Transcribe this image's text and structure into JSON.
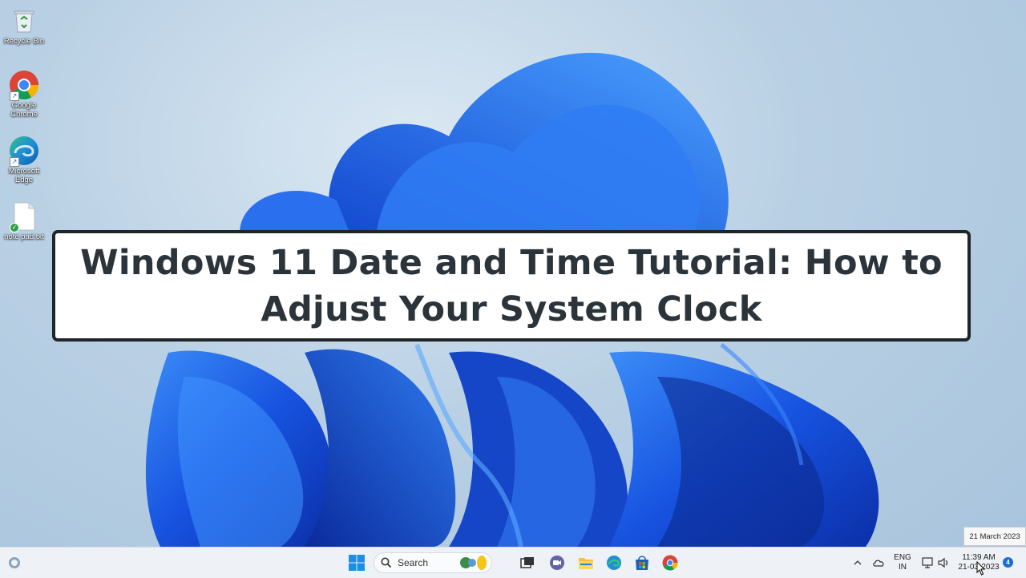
{
  "desktop_icons": [
    {
      "label": "Recycle Bin",
      "icon": "recycle-bin-icon"
    },
    {
      "label": "Google Chrome",
      "icon": "chrome-icon"
    },
    {
      "label": "Microsoft Edge",
      "icon": "edge-icon"
    },
    {
      "label": "note pad.txt",
      "icon": "text-file-icon"
    }
  ],
  "overlay": {
    "title_line1": "Windows 11 Date and Time Tutorial: How to",
    "title_line2": "Adjust Your System Clock"
  },
  "tooltip": {
    "date": "21 March 2023"
  },
  "taskbar": {
    "search_placeholder": "Search",
    "pinned": [
      "start-icon",
      "search-icon",
      "widgets-icon",
      "task-view-icon",
      "teams-chat-icon",
      "file-explorer-icon",
      "edge-icon",
      "store-icon",
      "chrome-icon"
    ],
    "tray": {
      "lang_line1": "ENG",
      "lang_line2": "IN",
      "time": "11:39 AM",
      "date": "21-03-2023",
      "notification_count": "4"
    }
  },
  "colors": {
    "bloom_blue": "#1a5ae0",
    "taskbar_bg": "#eef1f5",
    "title_border": "#1f2528",
    "title_text": "#2a343a"
  }
}
